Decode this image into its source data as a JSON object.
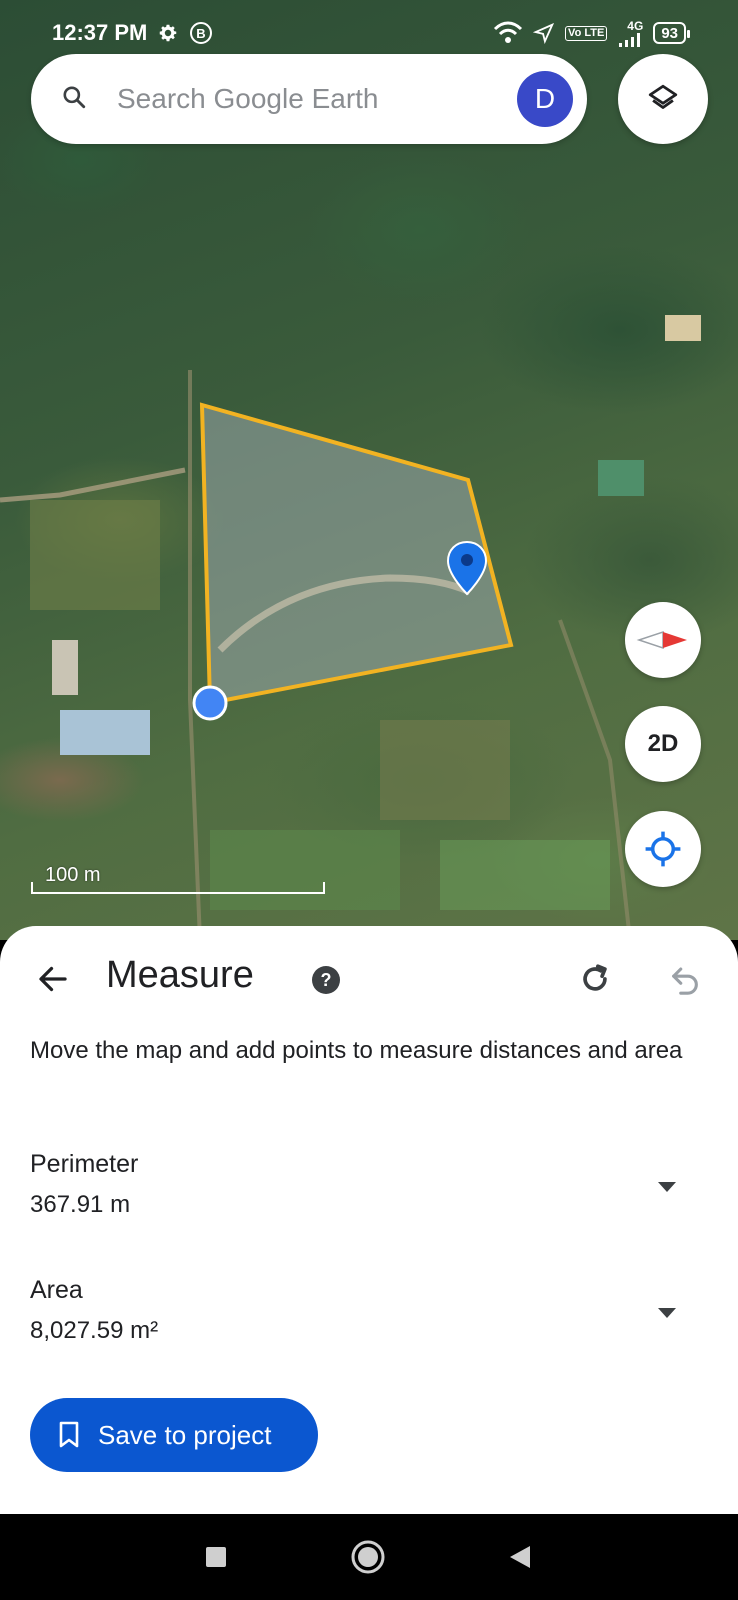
{
  "status_bar": {
    "time": "12:37 PM",
    "battery": "93",
    "network": "4G",
    "volte": "Vo LTE"
  },
  "search": {
    "placeholder": "Search Google Earth",
    "avatar_initial": "D"
  },
  "map": {
    "view_mode": "2D",
    "scale_label": "100 m",
    "polygon_color": "#f2b322",
    "vertex_color": "#4285f4",
    "pin_color": "#1a73e8"
  },
  "measure": {
    "title": "Measure",
    "help": "?",
    "instructions": "Move the map and add points to measure distances and area",
    "perimeter": {
      "label": "Perimeter",
      "value": "367.91 m"
    },
    "area": {
      "label": "Area",
      "value": "8,027.59 m²"
    },
    "save_label": "Save to project"
  },
  "colors": {
    "accent": "#0b57d0",
    "avatar": "#3949c8",
    "compass_red": "#e53935"
  },
  "icons": {
    "search": "search-icon",
    "layers": "layers-icon",
    "compass": "compass-icon",
    "locate": "my-location-icon",
    "back": "arrow-back-icon",
    "help": "help-icon",
    "redo": "redo-icon",
    "undo": "undo-icon",
    "dropdown": "dropdown-arrow-icon",
    "bookmark": "bookmark-icon"
  }
}
